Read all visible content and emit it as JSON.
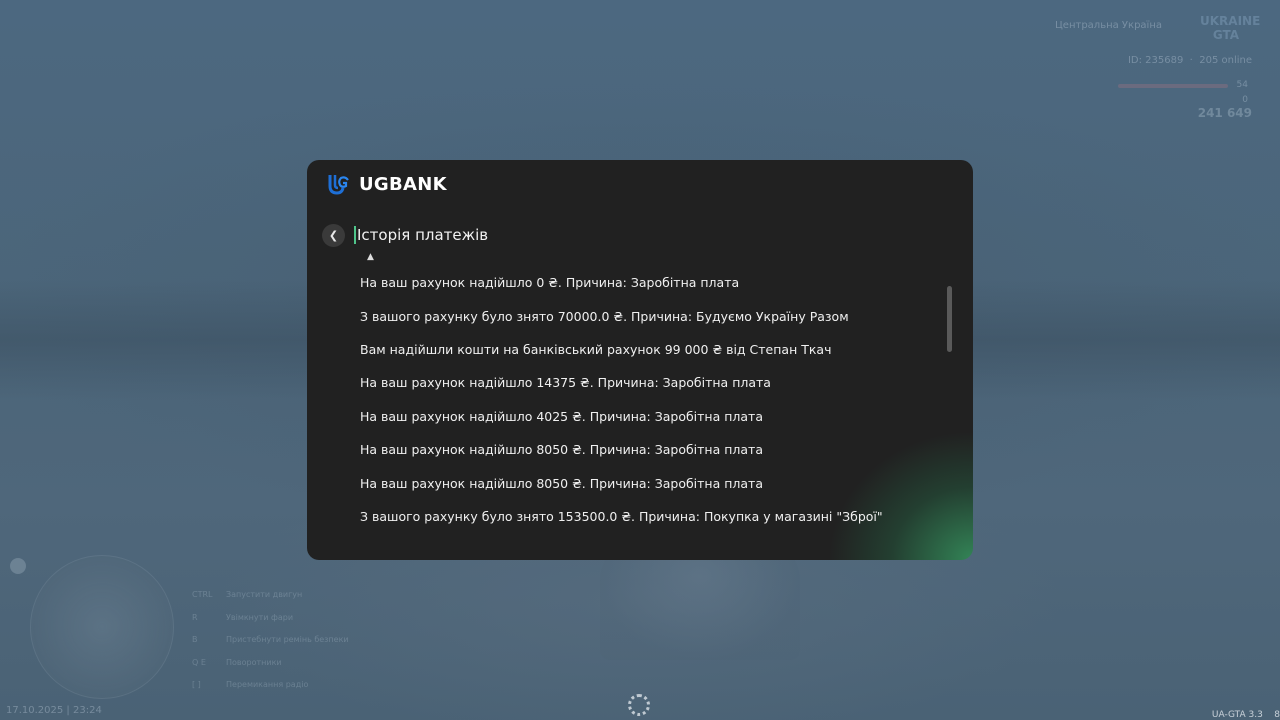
{
  "hud": {
    "region": "Центральна Україна",
    "logo": "UKRAINE GTA",
    "player_id": "ID: 235689",
    "online": "205 online",
    "stat1": "54",
    "stat2": "0",
    "money": "241 649",
    "date": "17.10.2025 | 23:24",
    "version": "UA-GTA 3.3",
    "version_extra": "8"
  },
  "hints": [
    {
      "key": "CTRL",
      "label": "Запустити двигун"
    },
    {
      "key": "R",
      "label": "Увімкнути фари"
    },
    {
      "key": "B",
      "label": "Пристебнути ремінь безпеки"
    },
    {
      "key": "Q E",
      "label": "Поворотники"
    },
    {
      "key": "[ ]",
      "label": "Перемикання радіо"
    }
  ],
  "bank": {
    "name": "UGBANK",
    "section_title": "Історія платежів",
    "history": [
      "На ваш рахунок надійшло 0 ₴. Причина: Заробітна плата",
      "З вашого рахунку було знято 70000.0 ₴. Причина: Будуємо Україну Разом",
      "Вам надійшли кошти на банківський рахунок 99 000 ₴ від Степан Ткач",
      "На ваш рахунок надійшло 14375 ₴. Причина: Заробітна плата",
      "На ваш рахунок надійшло 4025 ₴. Причина: Заробітна плата",
      "На ваш рахунок надійшло 8050 ₴. Причина: Заробітна плата",
      "На ваш рахунок надійшло 8050 ₴. Причина: Заробітна плата",
      "З вашого рахунку було знято 153500.0 ₴. Причина: Покупка у магазині  \"Зброї\""
    ]
  },
  "colors": {
    "modal_bg": "#212121",
    "accent_green": "#3b9a63",
    "logo_blue": "#1e6fd6"
  },
  "icons": {
    "back": "chevron-left-icon",
    "logo": "ugbank-logo-icon",
    "loading": "loading-spinner-icon"
  }
}
